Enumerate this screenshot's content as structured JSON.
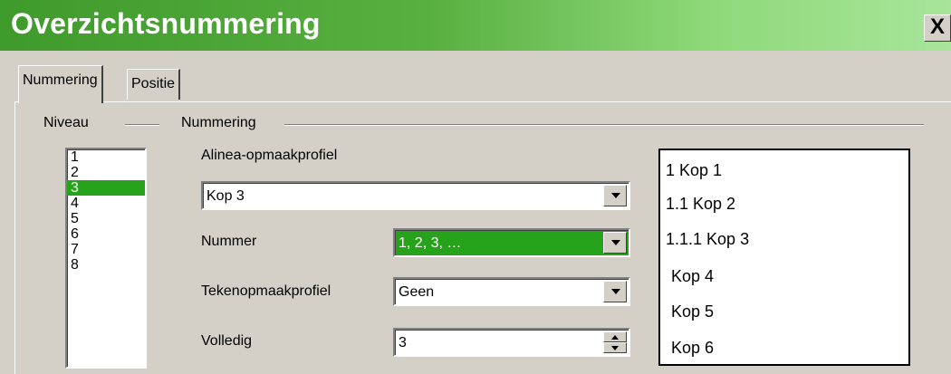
{
  "window": {
    "title": "Overzichtsnummering",
    "close_label": "X"
  },
  "tabs": [
    {
      "label": "Nummering",
      "active": true
    },
    {
      "label": "Positie",
      "active": false
    }
  ],
  "levels": {
    "label": "Niveau",
    "items": [
      "1",
      "2",
      "3",
      "4",
      "5",
      "6",
      "7",
      "8"
    ],
    "selected": "3"
  },
  "numbering": {
    "label": "Nummering",
    "paragraph_style": {
      "label": "Alinea-opmaakprofiel",
      "value": "Kop 3"
    },
    "number": {
      "label": "Nummer",
      "value": "1, 2, 3, …"
    },
    "char_style": {
      "label": "Tekenopmaakprofiel",
      "value": "Geen"
    },
    "complete": {
      "label": "Volledig",
      "value": "3"
    }
  },
  "preview": {
    "lines": [
      "1 Kop 1",
      "1.1 Kop 2",
      "1.1.1 Kop 3",
      "Kop 4",
      "Kop 5",
      "Kop 6"
    ]
  },
  "colors": {
    "accent": "#27a31b",
    "titlebar": "#58b040"
  }
}
